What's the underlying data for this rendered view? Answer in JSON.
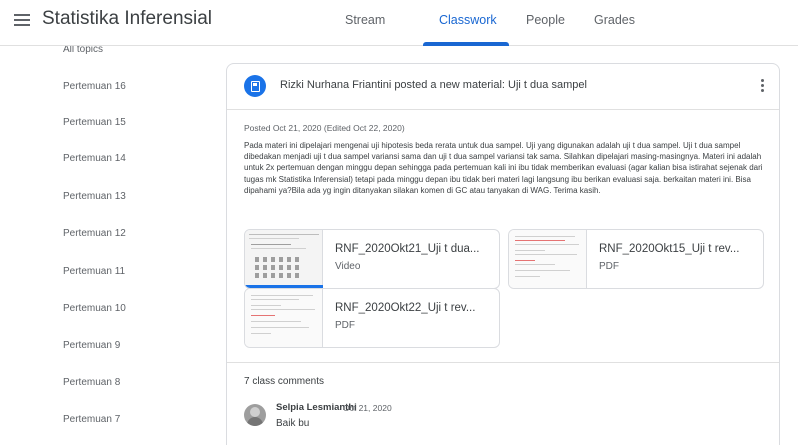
{
  "header": {
    "app_title": "Statistika Inferensial",
    "tabs": [
      {
        "label": "Stream"
      },
      {
        "label": "Classwork"
      },
      {
        "label": "People"
      },
      {
        "label": "Grades"
      }
    ],
    "active_tab": "Classwork",
    "accent_color": "#1967d2"
  },
  "sidebar": {
    "heading": "All topics",
    "items": [
      {
        "label": "Pertemuan 16"
      },
      {
        "label": "Pertemuan 15"
      },
      {
        "label": "Pertemuan 14"
      },
      {
        "label": "Pertemuan 13"
      },
      {
        "label": "Pertemuan 12"
      },
      {
        "label": "Pertemuan 11"
      },
      {
        "label": "Pertemuan 10"
      },
      {
        "label": "Pertemuan 9"
      },
      {
        "label": "Pertemuan 8"
      },
      {
        "label": "Pertemuan 7"
      }
    ]
  },
  "post": {
    "icon": "material-book-icon",
    "title": "Rizki Nurhana Friantini posted a new material: Uji t dua sampel",
    "posted": "Posted Oct 21, 2020 (Edited Oct 22, 2020)",
    "description": "Pada materi ini dipelajari mengenai uji hipotesis beda rerata untuk dua sampel. Uji yang digunakan adalah uji t dua sampel. Uji t dua sampel dibedakan menjadi uji t dua sampel variansi sama dan uji t dua sampel variansi tak sama. Silahkan dipelajari masing-masingnya. Materi ini adalah untuk 2x pertemuan dengan minggu depan sehingga pada pertemuan kali ini ibu tidak memberikan evaluasi (agar kalian bisa istirahat sejenak dari tugas mk Statistika Inferensial) tetapi pada minggu depan ibu tidak beri materi lagi langsung ibu berikan evaluasi saja. berkaitan materi ini. Bisa dipahami ya?Bila ada yg ingin ditanyakan silakan komen di GC atau tanyakan di WAG. Terima kasih.",
    "attachments": [
      {
        "name": "RNF_2020Okt21_Uji t dua...",
        "type": "Video"
      },
      {
        "name": "RNF_2020Okt15_Uji t rev...",
        "type": "PDF"
      },
      {
        "name": "RNF_2020Okt22_Uji t rev...",
        "type": "PDF"
      }
    ],
    "comments_count": "7 class comments",
    "comment": {
      "author": "Selpia Lesmianthi",
      "date": "Oct 21, 2020",
      "text": "Baik bu"
    }
  }
}
